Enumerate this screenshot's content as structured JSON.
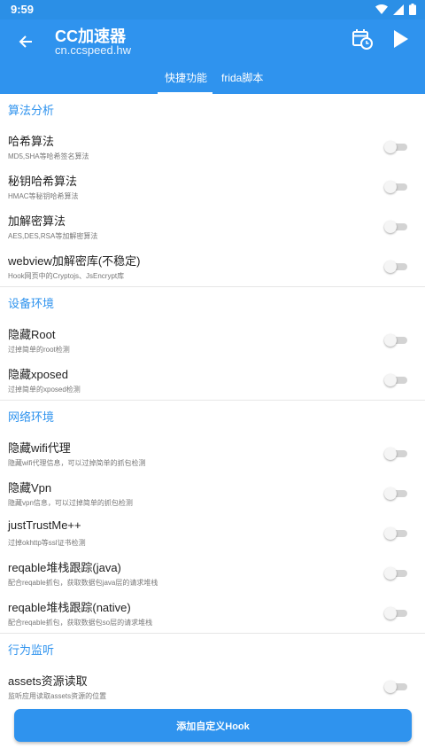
{
  "status_bar": {
    "time": "9:59",
    "icons": [
      "wifi-icon",
      "cellular-icon",
      "battery-icon"
    ]
  },
  "app_bar": {
    "title": "CC加速器",
    "subtitle": "cn.ccspeed.hw",
    "tabs": [
      {
        "label": "快捷功能",
        "selected": true
      },
      {
        "label": "frida脚本",
        "selected": false
      }
    ]
  },
  "sections": [
    {
      "title": "算法分析",
      "items": [
        {
          "title": "哈希算法",
          "desc": "MD5,SHA等哈希签名算法",
          "enabled": false
        },
        {
          "title": "秘钥哈希算法",
          "desc": "HMAC等秘钥哈希算法",
          "enabled": false
        },
        {
          "title": "加解密算法",
          "desc": "AES,DES,RSA等加解密算法",
          "enabled": false
        },
        {
          "title": "webview加解密库(不稳定)",
          "desc": "Hook网页中的Cryptojs、JsEncrypt库",
          "enabled": false
        }
      ]
    },
    {
      "title": "设备环境",
      "items": [
        {
          "title": "隐藏Root",
          "desc": "过掉简单的root检测",
          "enabled": false
        },
        {
          "title": "隐藏xposed",
          "desc": "过掉简单的xposed检测",
          "enabled": false
        }
      ]
    },
    {
      "title": "网络环境",
      "items": [
        {
          "title": "隐藏wifi代理",
          "desc": "隐藏wifi代理信息，可以过掉简单的抓包检测",
          "enabled": false
        },
        {
          "title": "隐藏Vpn",
          "desc": "隐藏vpn信息，可以过掉简单的抓包检测",
          "enabled": false
        },
        {
          "title": "justTrustMe++",
          "desc": "过掉okhttp等ssl证书检测",
          "enabled": false
        },
        {
          "title": "reqable堆栈跟踪(java)",
          "desc": "配合reqable抓包，获取数据包java层的请求堆栈",
          "enabled": false
        },
        {
          "title": "reqable堆栈跟踪(native)",
          "desc": "配合reqable抓包，获取数据包so层的请求堆栈",
          "enabled": false
        }
      ]
    },
    {
      "title": "行为监听",
      "items": [
        {
          "title": "assets资源读取",
          "desc": "监听应用读取assets资源的位置",
          "enabled": false
        }
      ]
    }
  ],
  "bottom": {
    "add_hook_label": "添加自定义Hook"
  },
  "colors": {
    "primary": "#2f93ee",
    "status_bar": "#2b8fe6",
    "switch_track": "#d3d3d3"
  }
}
